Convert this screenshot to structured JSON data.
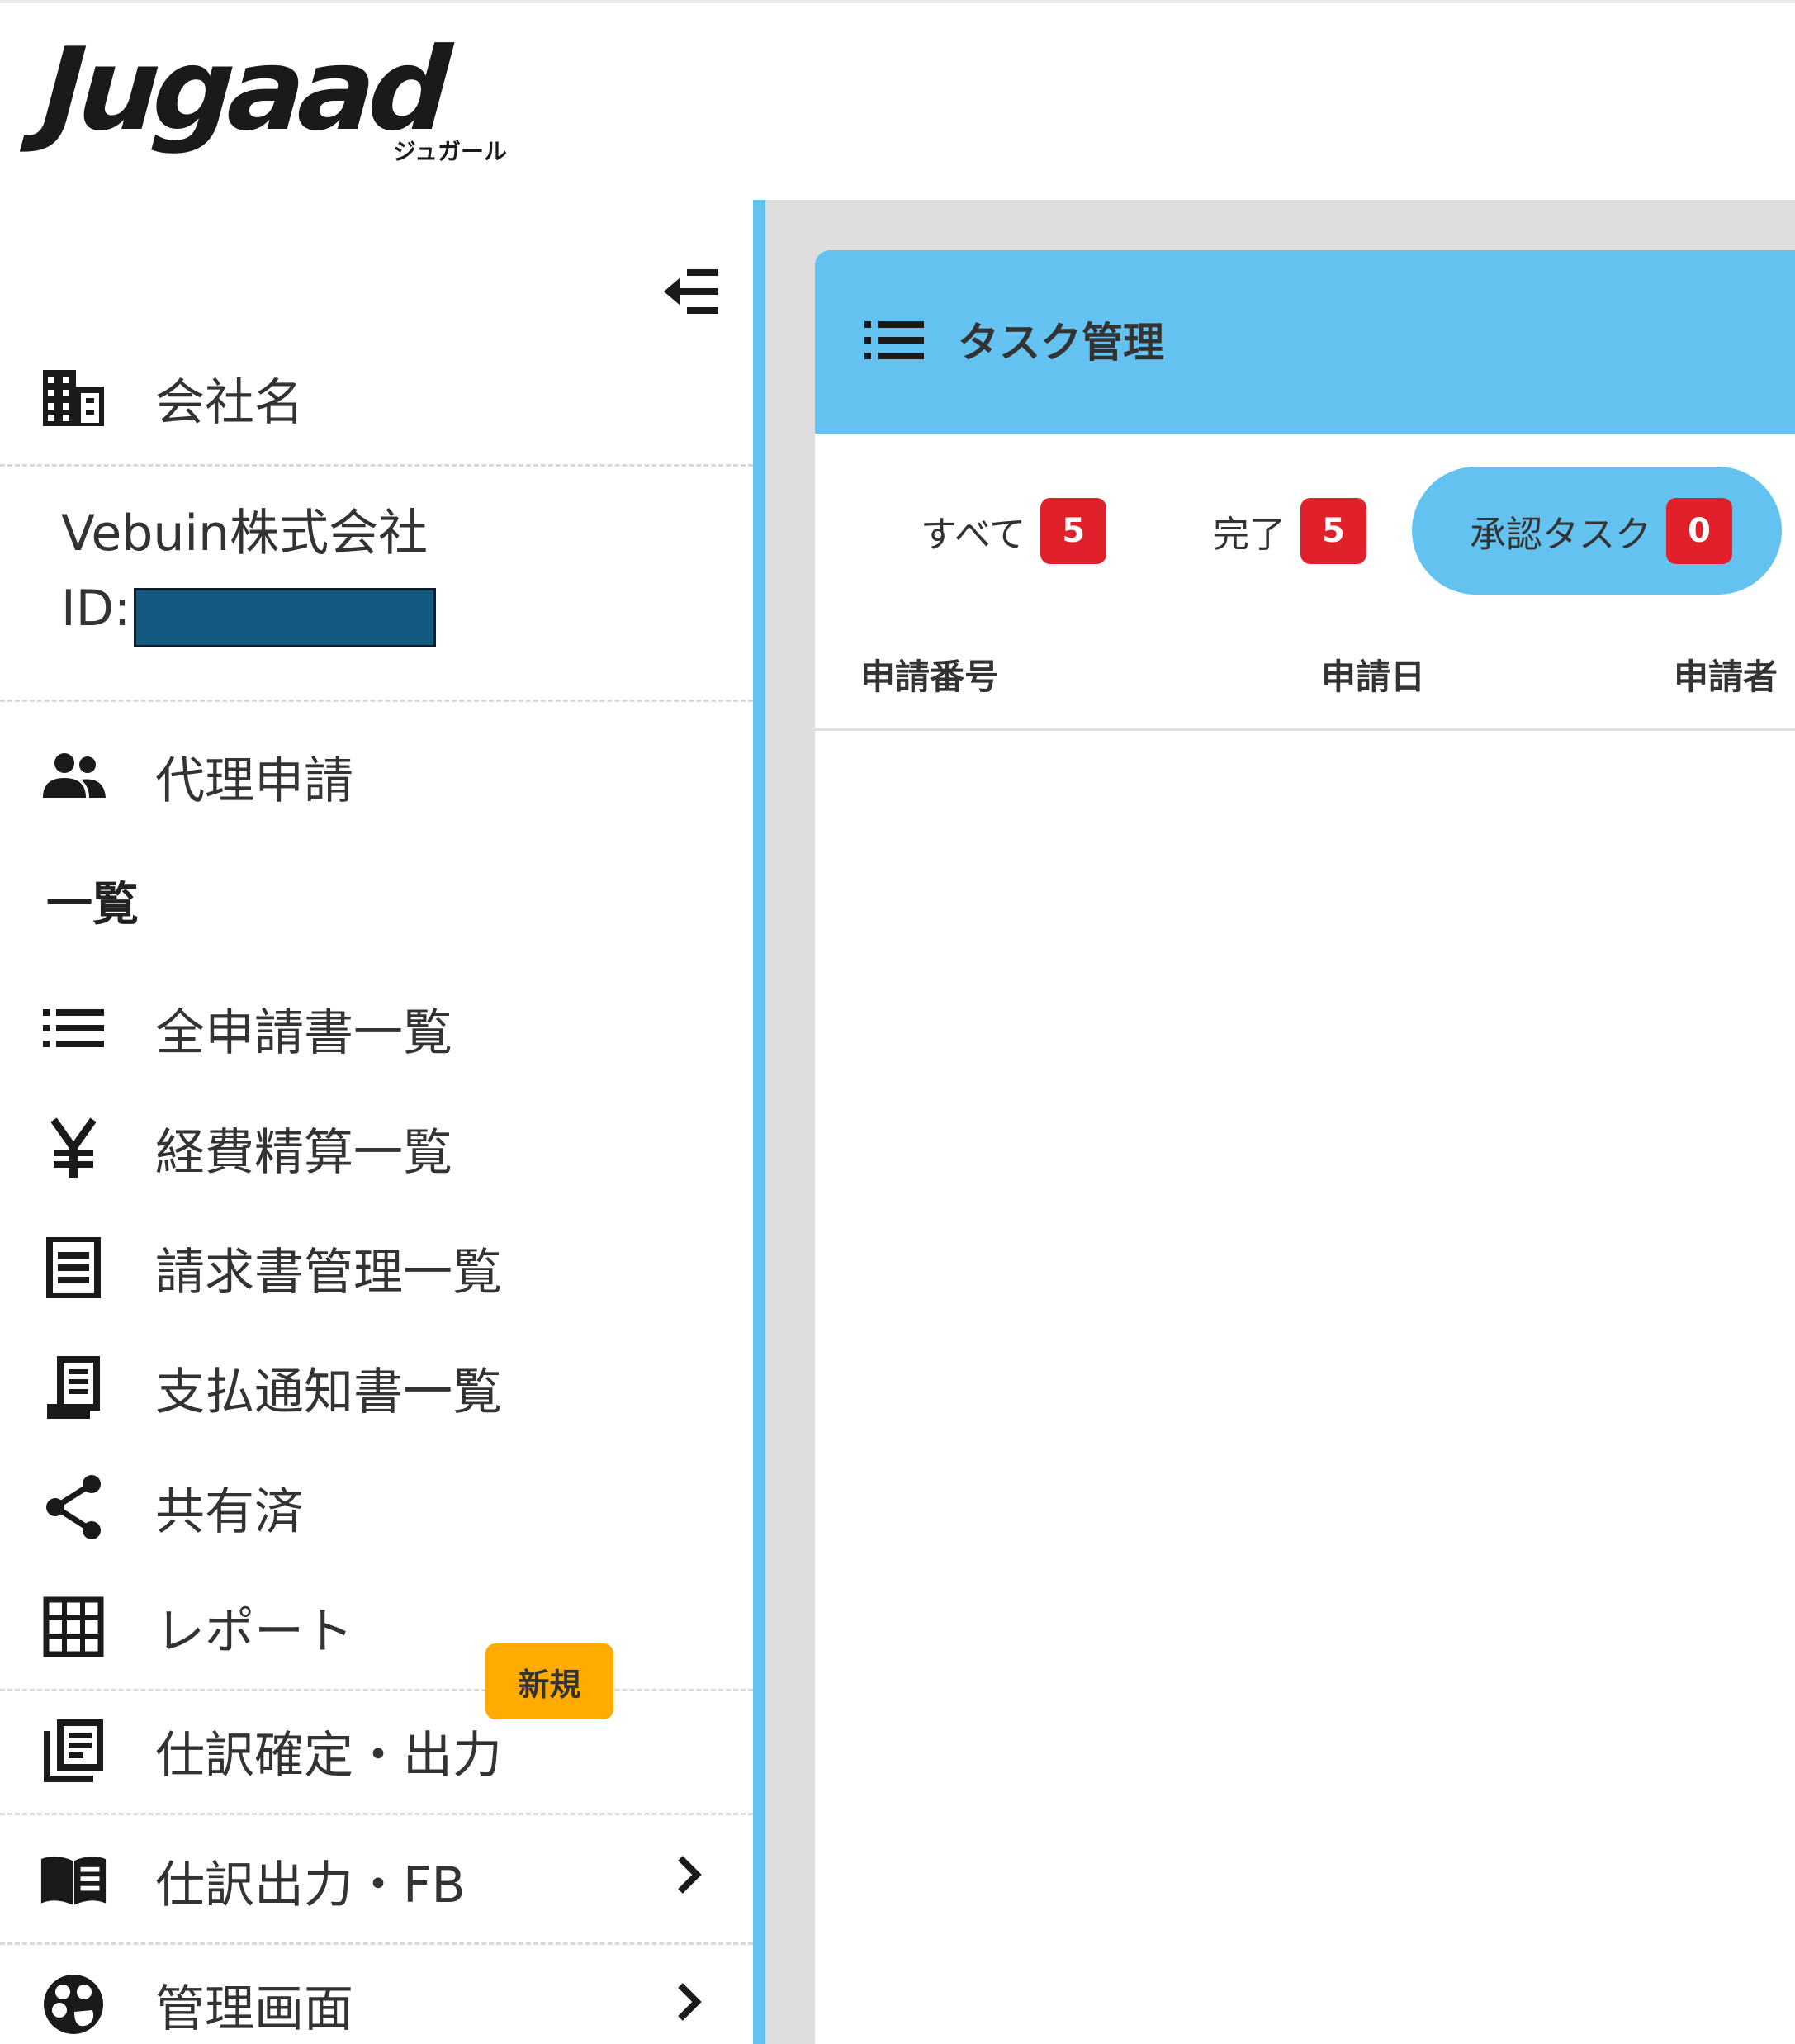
{
  "header": {
    "logo_text": "Jugaad",
    "logo_subtext": "ジュガール"
  },
  "sidebar": {
    "company_label": "会社名",
    "company_name": "Vebuin株式会社",
    "company_id_label": "ID:",
    "proxy_label": "代理申請",
    "section_title": "一覧",
    "items": [
      {
        "label": "全申請書一覧",
        "icon": "list-icon"
      },
      {
        "label": "経費精算一覧",
        "icon": "yen-icon"
      },
      {
        "label": "請求書管理一覧",
        "icon": "receipt-icon"
      },
      {
        "label": "支払通知書一覧",
        "icon": "notice-icon"
      },
      {
        "label": "共有済",
        "icon": "share-icon"
      },
      {
        "label": "レポート",
        "icon": "grid-icon"
      }
    ],
    "journal_confirm_label": "仕訳確定・出力",
    "journal_output_label": "仕訳出力・FB",
    "new_badge": "新規",
    "admin_label": "管理画面"
  },
  "main": {
    "title": "タスク管理",
    "tabs": [
      {
        "label": "すべて",
        "count": "5"
      },
      {
        "label": "完了",
        "count": "5"
      },
      {
        "label": "承認タスク",
        "count": "0"
      }
    ],
    "columns": [
      "申請番号",
      "申請日",
      "申請者"
    ]
  },
  "colors": {
    "accent": "#64c2f0",
    "badge_red": "#e0202b",
    "badge_new": "#ffab00",
    "redaction": "#135a80"
  }
}
